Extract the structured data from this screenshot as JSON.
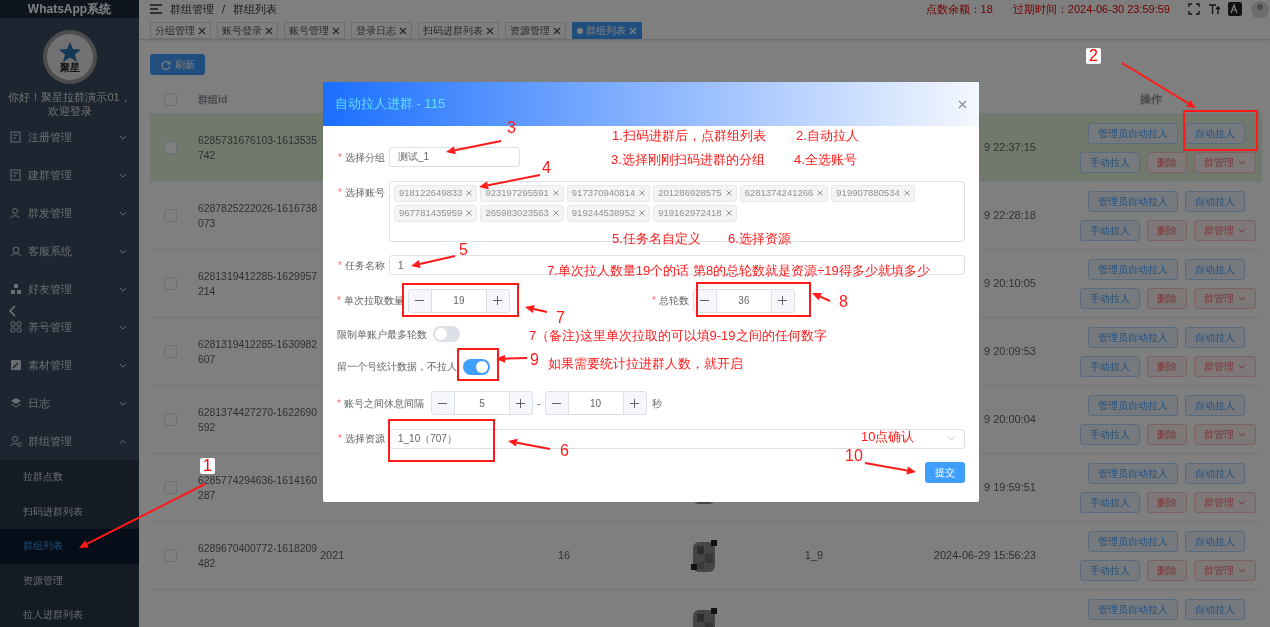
{
  "sidebar": {
    "title": "WhatsApp系统",
    "logo_text": "聚星",
    "welcome": "你好！聚星拉群演示01，欢迎登录",
    "menu": [
      {
        "label": "注册管理",
        "expanded": false
      },
      {
        "label": "建群管理",
        "expanded": false
      },
      {
        "label": "群发管理",
        "expanded": false
      },
      {
        "label": "客服系统",
        "expanded": false
      },
      {
        "label": "好友管理",
        "expanded": false
      },
      {
        "label": "养号管理",
        "expanded": false
      },
      {
        "label": "素材管理",
        "expanded": false
      },
      {
        "label": "日志",
        "expanded": false
      },
      {
        "label": "群组管理",
        "expanded": true,
        "children": [
          {
            "label": "拉群点数",
            "selected": false
          },
          {
            "label": "扫码进群列表",
            "selected": false
          },
          {
            "label": "群组列表",
            "selected": true
          },
          {
            "label": "资源管理",
            "selected": false
          },
          {
            "label": "拉人进群列表",
            "selected": false
          }
        ]
      }
    ]
  },
  "header": {
    "breadcrumb": [
      "群组管理",
      "群组列表"
    ],
    "separator": "/",
    "balance": "点数余额：18",
    "expiry": "过期时间：2024-06-30 23:59:59"
  },
  "tabs": [
    {
      "label": "分组管理",
      "selected": false
    },
    {
      "label": "账号登录",
      "selected": false
    },
    {
      "label": "账号管理",
      "selected": false
    },
    {
      "label": "登录日志",
      "selected": false
    },
    {
      "label": "扫码进群列表",
      "selected": false
    },
    {
      "label": "资源管理",
      "selected": false
    },
    {
      "label": "群组列表",
      "selected": true
    }
  ],
  "refresh_button": "刷新",
  "table": {
    "header_checked": false,
    "columns": [
      {
        "label": "群组id"
      },
      {
        "label": "操作"
      }
    ],
    "rows": [
      {
        "id": "6285731676103-1613535742",
        "time": "9 22:37:15",
        "highlighted": true,
        "checked": false,
        "actions": [
          {
            "label": "管理员自动拉人",
            "kind": "primary"
          },
          {
            "label": "自动拉人",
            "kind": "primary"
          },
          {
            "label": "手动拉人",
            "kind": "primary"
          },
          {
            "label": "删除",
            "kind": "danger"
          },
          {
            "label": "群管理",
            "kind": "menu"
          }
        ]
      },
      {
        "id": "6287825222026-1616738073",
        "time": "9 22:28:18",
        "highlighted": false,
        "checked": false,
        "actions": [
          {
            "label": "管理员自动拉人",
            "kind": "primary"
          },
          {
            "label": "自动拉人",
            "kind": "primary"
          },
          {
            "label": "手动拉人",
            "kind": "primary"
          },
          {
            "label": "删除",
            "kind": "danger"
          },
          {
            "label": "群管理",
            "kind": "menu"
          }
        ]
      },
      {
        "id": "6281319412285-1629957214",
        "time": "9 20:10:05",
        "highlighted": false,
        "checked": false,
        "actions": [
          {
            "label": "管理员自动拉人",
            "kind": "primary"
          },
          {
            "label": "自动拉人",
            "kind": "primary"
          },
          {
            "label": "手动拉人",
            "kind": "primary"
          },
          {
            "label": "删除",
            "kind": "danger"
          },
          {
            "label": "群管理",
            "kind": "menu"
          }
        ]
      },
      {
        "id": "6281319412285-1630982607",
        "time": "9 20:09:53",
        "highlighted": false,
        "checked": false,
        "actions": [
          {
            "label": "管理员自动拉人",
            "kind": "primary"
          },
          {
            "label": "自动拉人",
            "kind": "primary"
          },
          {
            "label": "手动拉人",
            "kind": "primary"
          },
          {
            "label": "删除",
            "kind": "danger"
          },
          {
            "label": "群管理",
            "kind": "menu"
          }
        ]
      },
      {
        "id": "6281374427270-1622690592",
        "time": "9 20:00:04",
        "highlighted": false,
        "checked": false,
        "actions": [
          {
            "label": "管理员自动拉人",
            "kind": "primary"
          },
          {
            "label": "自动拉人",
            "kind": "primary"
          },
          {
            "label": "手动拉人",
            "kind": "primary"
          },
          {
            "label": "删除",
            "kind": "danger"
          },
          {
            "label": "群管理",
            "kind": "menu"
          }
        ]
      },
      {
        "id": "6285774294636-1614160287",
        "time": "9 19:59:51",
        "highlighted": false,
        "checked": false,
        "actions": [
          {
            "label": "管理员自动拉人",
            "kind": "primary"
          },
          {
            "label": "自动拉人",
            "kind": "primary"
          },
          {
            "label": "手动拉人",
            "kind": "primary"
          },
          {
            "label": "删除",
            "kind": "danger"
          },
          {
            "label": "群管理",
            "kind": "menu"
          }
        ]
      },
      {
        "id": "6289670400772-1618209482",
        "column_3": "2021",
        "column_4": "16",
        "column_6": "1_9",
        "time": "2024-06-29 15:56:23",
        "highlighted": false,
        "checked": false,
        "actions": [
          {
            "label": "管理员自动拉人",
            "kind": "primary"
          },
          {
            "label": "自动拉人",
            "kind": "primary"
          },
          {
            "label": "手动拉人",
            "kind": "primary"
          },
          {
            "label": "删除",
            "kind": "danger"
          },
          {
            "label": "群管理",
            "kind": "menu"
          }
        ]
      },
      {
        "highlighted": false,
        "actions": [
          {
            "label": "管理员自动拉人",
            "kind": "primary"
          },
          {
            "label": "自动拉人",
            "kind": "primary"
          }
        ]
      }
    ]
  },
  "modal": {
    "title": "自动拉人进群 - 115",
    "fields": [
      {
        "kind": "input",
        "mark": "*",
        "label": "选择分组",
        "value": "测试_1"
      },
      {
        "kind": "tags",
        "mark": "*",
        "label": "选择账号",
        "tags": [
          "918122649833",
          "923197295591",
          "917370940814",
          "201286928575",
          "6281374241266",
          "919907880534",
          "967781435959",
          "265983023563",
          "919244538952",
          "919162972418"
        ]
      },
      {
        "kind": "wide",
        "mark": "*",
        "label": "任务名称",
        "value": "1"
      },
      {
        "kind": "pair",
        "items": [
          {
            "mark": "*",
            "label": "单次拉取数量",
            "value": "19"
          },
          {
            "mark": "*",
            "label": "总轮数",
            "value": "36"
          }
        ]
      },
      {
        "kind": "switch",
        "label": "限制单账户最多轮数",
        "on": false
      },
      {
        "kind": "switch",
        "label": "留一个号统计数据，不拉人",
        "on": true
      },
      {
        "kind": "range",
        "mark": "*",
        "label": "账号之间休息间隔",
        "from": "5",
        "separator": "-",
        "to": "10",
        "unit": "秒"
      },
      {
        "kind": "select",
        "mark": "*",
        "label": "选择资源",
        "value": "1_10（707）"
      }
    ],
    "submit": "提交"
  },
  "annotations": [
    {
      "kind": "number",
      "text": "2"
    },
    {
      "kind": "number",
      "text": "3"
    },
    {
      "kind": "note",
      "text": "1.扫码进群后，点群组列表"
    },
    {
      "kind": "note",
      "text": "2.自动拉人"
    },
    {
      "kind": "number",
      "text": "4"
    },
    {
      "kind": "note",
      "text": "3.选择刚刚扫码进群的分组"
    },
    {
      "kind": "note",
      "text": "4.全选账号"
    },
    {
      "kind": "note",
      "text": "5.任务名自定义"
    },
    {
      "kind": "note",
      "text": "6.选择资源"
    },
    {
      "kind": "number",
      "text": "5"
    },
    {
      "kind": "note",
      "text": "7.单次拉人数量19个的话 第8的总轮数就是资源÷19得多少就填多少"
    },
    {
      "kind": "number",
      "text": "8"
    },
    {
      "kind": "number",
      "text": "7"
    },
    {
      "kind": "note",
      "text": "7（备注)这里单次拉取的可以填9-19之间的任何数字"
    },
    {
      "kind": "number",
      "text": "9"
    },
    {
      "kind": "note",
      "text": "如果需要统计拉进群人数，就开启"
    },
    {
      "kind": "note",
      "text": "10点确认"
    },
    {
      "kind": "number",
      "text": "6"
    },
    {
      "kind": "number",
      "text": "10"
    },
    {
      "kind": "number",
      "text": "1"
    }
  ]
}
